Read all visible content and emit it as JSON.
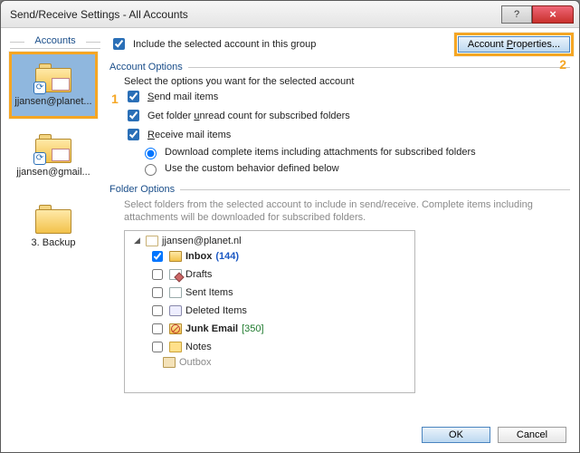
{
  "window": {
    "title": "Send/Receive Settings - All Accounts"
  },
  "sidebar": {
    "header": "Accounts",
    "items": [
      {
        "label": "jjansen@planet..."
      },
      {
        "label": "jjansen@gmail..."
      },
      {
        "label": "3. Backup"
      }
    ]
  },
  "top": {
    "include_label": "Include the selected account in this group",
    "acct_props_btn": "Account Properties..."
  },
  "badges": {
    "one": "1",
    "two": "2"
  },
  "account_options": {
    "title": "Account Options",
    "intro": "Select the options you want for the selected account",
    "send_label": "Send mail items",
    "unread_label": "Get folder unread count for subscribed folders",
    "receive_label": "Receive mail items",
    "r1": "Download complete items including attachments for subscribed folders",
    "r2": "Use the custom behavior defined below"
  },
  "folder_options": {
    "title": "Folder Options",
    "intro": "Select folders from the selected account to include in send/receive. Complete items including attachments will be downloaded for subscribed folders.",
    "root": "jjansen@planet.nl",
    "items": {
      "inbox": "Inbox",
      "inbox_count": "(144)",
      "drafts": "Drafts",
      "sent": "Sent Items",
      "deleted": "Deleted Items",
      "junk": "Junk Email",
      "junk_count": "[350]",
      "notes": "Notes",
      "outbox": "Outbox"
    }
  },
  "footer": {
    "ok": "OK",
    "cancel": "Cancel"
  }
}
